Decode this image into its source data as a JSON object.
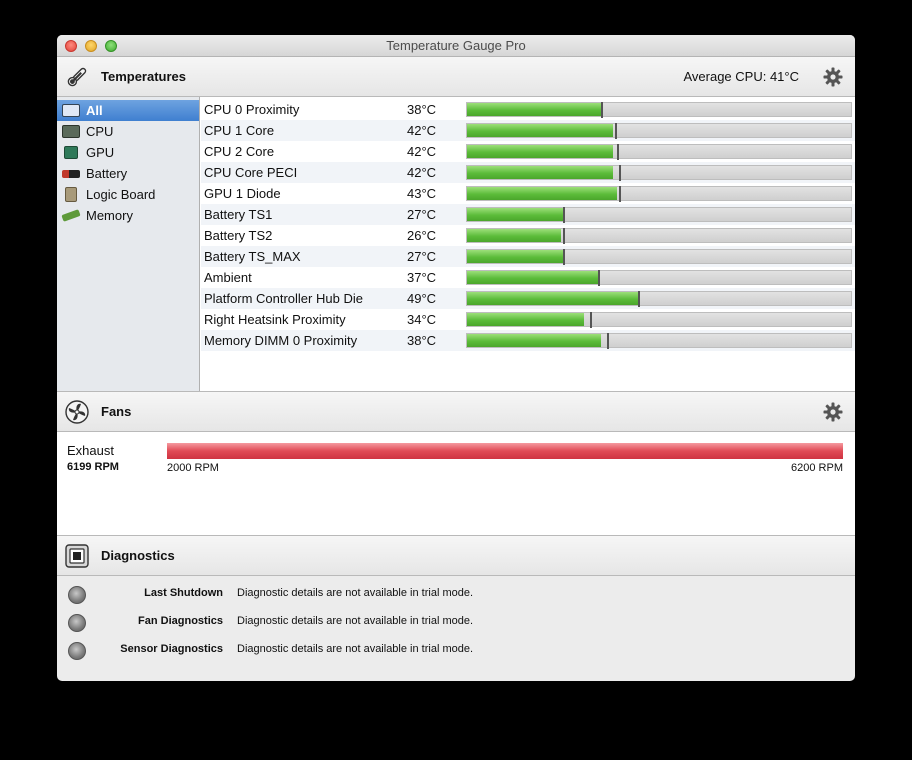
{
  "window": {
    "title": "Temperature Gauge Pro"
  },
  "temperatures": {
    "title": "Temperatures",
    "average_label": "Average CPU:",
    "average_value": "41°C",
    "sidebar": [
      {
        "label": "All",
        "icon": "all-sensors-icon",
        "selected": true
      },
      {
        "label": "CPU",
        "icon": "cpu-icon"
      },
      {
        "label": "GPU",
        "icon": "gpu-icon"
      },
      {
        "label": "Battery",
        "icon": "battery-icon"
      },
      {
        "label": "Logic Board",
        "icon": "logic-board-icon"
      },
      {
        "label": "Memory",
        "icon": "memory-icon"
      }
    ],
    "sensors": [
      {
        "name": "CPU 0 Proximity",
        "value": "38°C",
        "fill": 0.35,
        "marker": 0.35
      },
      {
        "name": "CPU 1 Core",
        "value": "42°C",
        "fill": 0.38,
        "marker": 0.385
      },
      {
        "name": "CPU 2 Core",
        "value": "42°C",
        "fill": 0.38,
        "marker": 0.39
      },
      {
        "name": "CPU Core PECI",
        "value": "42°C",
        "fill": 0.38,
        "marker": 0.395
      },
      {
        "name": "GPU 1 Diode",
        "value": "43°C",
        "fill": 0.39,
        "marker": 0.395
      },
      {
        "name": "Battery TS1",
        "value": "27°C",
        "fill": 0.25,
        "marker": 0.25
      },
      {
        "name": "Battery TS2",
        "value": "26°C",
        "fill": 0.245,
        "marker": 0.25
      },
      {
        "name": "Battery TS_MAX",
        "value": "27°C",
        "fill": 0.25,
        "marker": 0.25
      },
      {
        "name": "Ambient",
        "value": "37°C",
        "fill": 0.34,
        "marker": 0.34
      },
      {
        "name": "Platform Controller Hub Die",
        "value": "49°C",
        "fill": 0.445,
        "marker": 0.445
      },
      {
        "name": "Right Heatsink Proximity",
        "value": "34°C",
        "fill": 0.305,
        "marker": 0.32
      },
      {
        "name": "Memory DIMM 0 Proximity",
        "value": "38°C",
        "fill": 0.35,
        "marker": 0.365
      }
    ]
  },
  "fans": {
    "title": "Fans",
    "items": [
      {
        "name": "Exhaust",
        "rpm": "6199 RPM",
        "min": "2000 RPM",
        "max": "6200 RPM",
        "fill": 0.9998
      }
    ]
  },
  "diagnostics": {
    "title": "Diagnostics",
    "items": [
      {
        "label": "Last Shutdown",
        "text": "Diagnostic details are not available in trial mode."
      },
      {
        "label": "Fan Diagnostics",
        "text": "Diagnostic details are not available in trial mode."
      },
      {
        "label": "Sensor Diagnostics",
        "text": "Diagnostic details are not available in trial mode."
      }
    ]
  },
  "colors": {
    "temp_bar": "#5cbc3a",
    "fan_bar": "#e04a55",
    "selection": "#3f7fd0"
  }
}
